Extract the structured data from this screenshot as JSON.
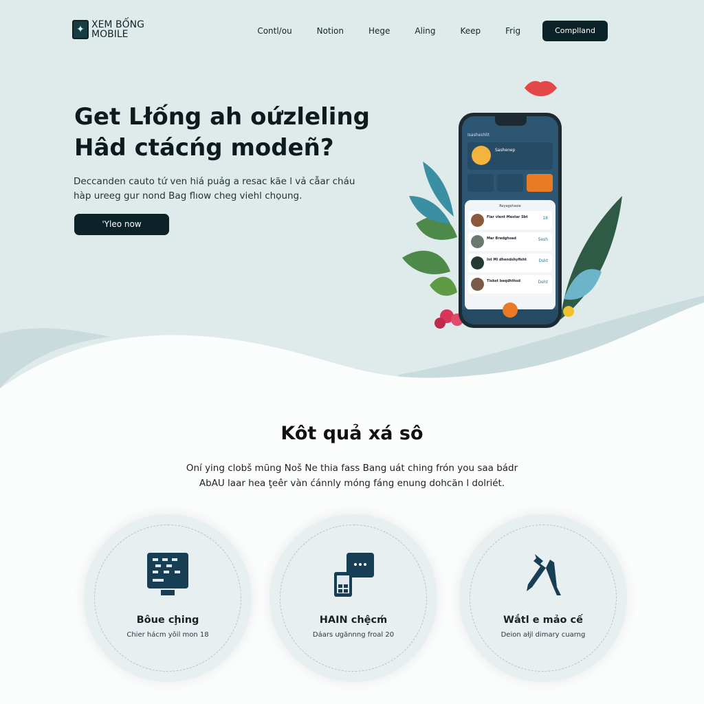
{
  "brand": {
    "name": "XEM BỐNG MOBILE"
  },
  "nav": {
    "items": [
      "Contl/ou",
      "Notion",
      "Hege",
      "Aling",
      "Keep",
      "Frig"
    ],
    "cta": "Complland"
  },
  "hero": {
    "title": "Get Lłống ah oứzleling Hâd ctácńg modeñ?",
    "description": "Deccanden cauto tứ ven hiá puảg a resac kãe l vả cẫar cháu hàp ureeg gur nond Bag flıow cheg viehl chọung.",
    "button": "'Yleo now"
  },
  "phone": {
    "header": "Isasheshlit",
    "profile_name": "Sashenep",
    "list_title": "Reyagshasie",
    "items": [
      {
        "title": "Flar vlent Mestar Sbt",
        "badge": "18"
      },
      {
        "title": "Mar Bredghsad",
        "badge": "Sesh"
      },
      {
        "title": "Int Ml dhendshyfisht",
        "badge": "Dskt"
      },
      {
        "title": "Tisbst beqdhthsd",
        "badge": "Deht"
      }
    ]
  },
  "section": {
    "title": "Kôt quả xá sô",
    "description": "Oní ying clobš mũng Noš Ne thia fass Bang uát ching frón you saa bádr AbAU laar hea ţeêr vàn ćánnly móng fáng enung dohcăn l dolriét."
  },
  "features": [
    {
      "icon": "monitor-icon",
      "title": "Bôue cḩing",
      "subtitle": "Chier hácm yôil mon 18"
    },
    {
      "icon": "phone-chat-icon",
      "title": "HAIN chệcḿ",
      "subtitle": "Dáars ưgănnng froal 20"
    },
    {
      "icon": "tools-icon",
      "title": "Wắtl e mảo cế",
      "subtitle": "Deion ałjl dimary cuarng"
    }
  ],
  "colors": {
    "dark": "#0c2229",
    "hero_bg": "#dfebeb",
    "accent": "#e97a26",
    "phone_blue": "#2c5672"
  }
}
